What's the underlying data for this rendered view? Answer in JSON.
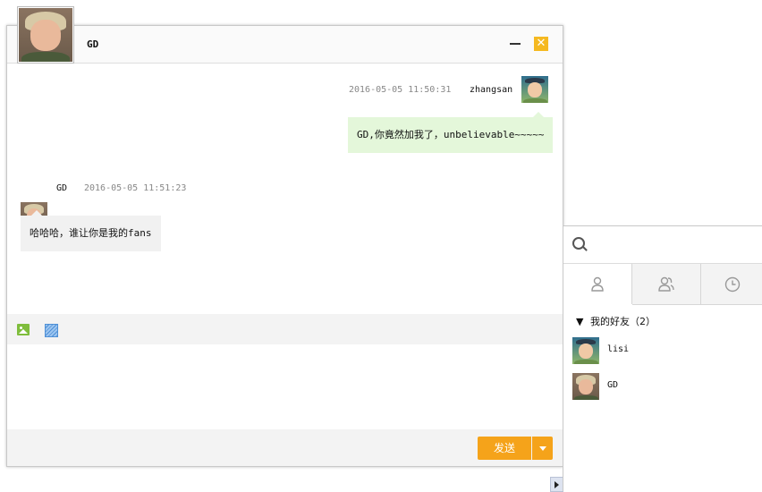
{
  "chat": {
    "title": "GD",
    "messages": [
      {
        "sender": "zhangsan",
        "time": "2016-05-05 11:50:31",
        "text": "GD,你竟然加我了，unbelievable~~~~~",
        "side": "right"
      },
      {
        "sender": "GD",
        "time": "2016-05-05 11:51:23",
        "text": "哈哈哈，谁让你是我的fans",
        "side": "left"
      }
    ],
    "toolbar": {
      "image_icon": "image-icon",
      "screenshot_icon": "screenshot-icon"
    },
    "compose_value": "",
    "send_label": "发送"
  },
  "friends_panel": {
    "search_placeholder": "",
    "tabs": [
      {
        "icon": "person-icon",
        "selected": true
      },
      {
        "icon": "group-icon",
        "selected": false
      },
      {
        "icon": "clock-icon",
        "selected": false
      }
    ],
    "group": {
      "arrow": "▼",
      "label": "我的好友（2）"
    },
    "friends": [
      {
        "name": "lisi"
      },
      {
        "name": "GD"
      }
    ]
  },
  "colors": {
    "accent": "#f5a31a",
    "close_button": "#f5b921",
    "sent_bubble": "#e4f7da",
    "received_bubble": "#f1f1f1"
  }
}
